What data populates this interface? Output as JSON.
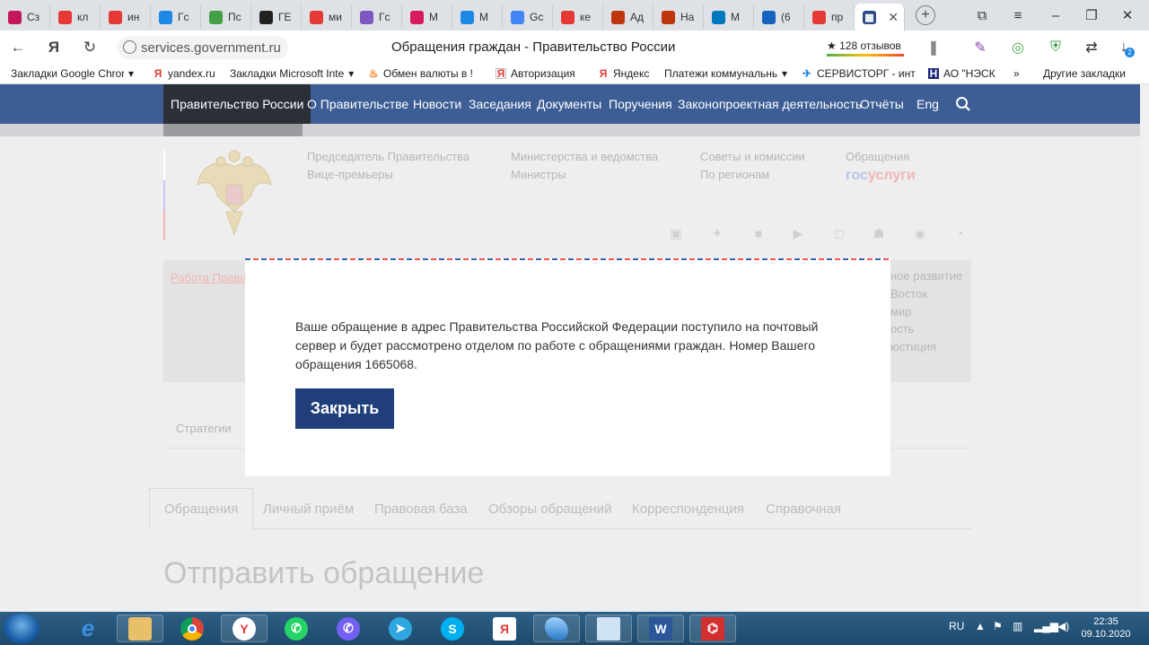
{
  "browser": {
    "tabs": [
      {
        "icon": "orbit-icon",
        "label": "Сз",
        "color": "#c2185b"
      },
      {
        "icon": "yandex-icon",
        "label": "кл",
        "color": "#e53935"
      },
      {
        "icon": "yandex-icon",
        "label": "ин",
        "color": "#e53935"
      },
      {
        "icon": "map-pin-icon",
        "label": "Гс",
        "color": "#1e88e5"
      },
      {
        "icon": "map-icon",
        "label": "Пс",
        "color": "#43a047"
      },
      {
        "icon": "grid-icon",
        "label": "ГЕ",
        "color": "#212121"
      },
      {
        "icon": "yandex-icon",
        "label": "ми",
        "color": "#e53935"
      },
      {
        "icon": "letter-c-icon",
        "label": "Гс",
        "color": "#7e57c2"
      },
      {
        "icon": "instagram-icon",
        "label": "М",
        "color": "#d81b60"
      },
      {
        "icon": "vk-icon",
        "label": "М",
        "color": "#1e88e5"
      },
      {
        "icon": "google-icon",
        "label": "Gc",
        "color": "#4285f4"
      },
      {
        "icon": "yandex-icon",
        "label": "ке",
        "color": "#e53935"
      },
      {
        "icon": "coat-of-arms-icon",
        "label": "Ад",
        "color": "#bf360c"
      },
      {
        "icon": "coat-of-arms-icon",
        "label": "На",
        "color": "#bf360c"
      },
      {
        "icon": "at-icon",
        "label": "М",
        "color": "#0277bd"
      },
      {
        "icon": "mail-icon",
        "label": "(6",
        "color": "#1565c0"
      },
      {
        "icon": "yandex-icon",
        "label": "пр",
        "color": "#e53935"
      }
    ],
    "active_tab_icon": "government-icon",
    "url": "services.government.ru",
    "page_title": "Обращения граждан - Правительство России",
    "reviews": "★ 128 отзывов",
    "download_badge": "2",
    "bookmarks": [
      {
        "label": "Закладки Google Chror",
        "icon": "",
        "arrow": "▾"
      },
      {
        "label": "yandex.ru",
        "icon": "yandex-icon",
        "arrow": ""
      },
      {
        "label": "Закладки Microsoft Inte",
        "icon": "",
        "arrow": "▾"
      },
      {
        "label": "Обмен валюты в !",
        "icon": "flame-icon",
        "arrow": ""
      },
      {
        "label": "Авторизация",
        "icon": "yandex-icon",
        "arrow": ""
      },
      {
        "label": "Яндекс",
        "icon": "yandex-icon",
        "arrow": ""
      },
      {
        "label": "Платежи коммунальны",
        "icon": "",
        "arrow": "▾"
      },
      {
        "label": "СЕРВИСТОРГ - инт",
        "icon": "airplane-icon",
        "arrow": ""
      },
      {
        "label": "АО \"НЭСК",
        "icon": "letter-n-icon",
        "arrow": ""
      }
    ],
    "bookmarks_more": "»",
    "other_bookmarks": "Другие закладки"
  },
  "site": {
    "nav": [
      "Правительство России",
      "О Правительстве",
      "Новости",
      "Заседания",
      "Документы",
      "Поручения",
      "Законопроектная деятельность",
      "Отчёты",
      "Eng"
    ],
    "header_links": {
      "col1": [
        "Председатель Правительства",
        "Вице-премьеры"
      ],
      "col2": [
        "Министерства и ведомства",
        "Министры"
      ],
      "col3": [
        "Советы и комиссии",
        "По регионам"
      ],
      "col4": [
        "Обращения"
      ]
    },
    "gosuslugi_a": "гос",
    "gosuslugi_b": "услуги",
    "left_link": "Работа Прави",
    "right_fragments": [
      "ное развитие",
      "Восток",
      "мир",
      "ость",
      "юстиция"
    ],
    "strategies": "Стратегии",
    "tabs": [
      "Обращения",
      "Личный приём",
      "Правовая база",
      "Обзоры обращений",
      "Корреспонденция",
      "Справочная"
    ],
    "page_heading": "Отправить обращение"
  },
  "modal": {
    "message": "Ваше обращение в адрес Правительства Российской Федерации поступило на почтовый сервер и будет рассмотрено отделом по работе с обращениями граждан. Номер Вашего обращения 1665068.",
    "close_label": "Закрыть"
  },
  "taskbar": {
    "language": "RU",
    "time": "22:35",
    "date": "09.10.2020"
  }
}
